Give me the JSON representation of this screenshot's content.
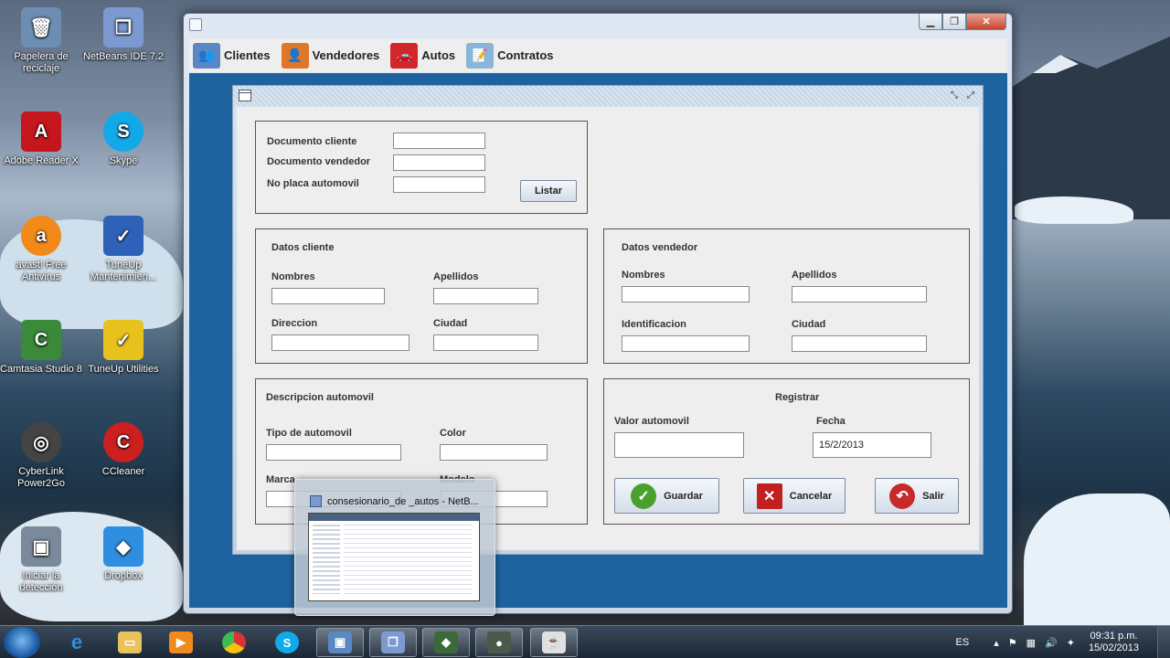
{
  "desktop": {
    "icons": [
      {
        "label": "Papelera de reciclaje",
        "glyph": "🗑",
        "color": "#6d8db3"
      },
      {
        "label": "NetBeans IDE 7.2",
        "glyph": "❒",
        "color": "#7c9ad0"
      },
      {
        "label": "Adobe Reader X",
        "glyph": "A",
        "color": "#c4161c"
      },
      {
        "label": "Skype",
        "glyph": "S",
        "color": "#12a9e9"
      },
      {
        "label": "avast! Free Antivirus",
        "glyph": "a",
        "color": "#f28a1a"
      },
      {
        "label": "TuneUp Mantenimien...",
        "glyph": "✓",
        "color": "#2d62b8"
      },
      {
        "label": "Camtasia Studio 8",
        "glyph": "C",
        "color": "#3a8a3a"
      },
      {
        "label": "TuneUp Utilities",
        "glyph": "✓",
        "color": "#e7c21c"
      },
      {
        "label": "CyberLink Power2Go",
        "glyph": "◎",
        "color": "#444444"
      },
      {
        "label": "CCleaner",
        "glyph": "C",
        "color": "#cc2020"
      },
      {
        "label": "Iniciar la detección",
        "glyph": "▣",
        "color": "#7a8a9a"
      },
      {
        "label": "Dropbox",
        "glyph": "◆",
        "color": "#2e8ee0"
      }
    ]
  },
  "window": {
    "menu": [
      {
        "label": "Clientes",
        "icon": "clients-icon",
        "glyph": "👥",
        "color": "#5b87c4"
      },
      {
        "label": "Vendedores",
        "icon": "seller-icon",
        "glyph": "👤",
        "color": "#e0762a"
      },
      {
        "label": "Autos",
        "icon": "car-icon",
        "glyph": "🚗",
        "color": "#d3262a"
      },
      {
        "label": "Contratos",
        "icon": "contract-icon",
        "glyph": "📝",
        "color": "#8ab4d8"
      }
    ]
  },
  "form": {
    "search": {
      "doc_cliente_label": "Documento cliente",
      "doc_vendedor_label": "Documento vendedor",
      "placa_label": "No placa automovil",
      "listar_button": "Listar"
    },
    "cliente": {
      "title": "Datos cliente",
      "nombres_label": "Nombres",
      "apellidos_label": "Apellidos",
      "direccion_label": "Direccion",
      "ciudad_label": "Ciudad"
    },
    "vendedor": {
      "title": "Datos vendedor",
      "nombres_label": "Nombres",
      "apellidos_label": "Apellidos",
      "identificacion_label": "Identificacion",
      "ciudad_label": "Ciudad"
    },
    "automovil": {
      "title": "Descripcion automovil",
      "tipo_label": "Tipo de automovil",
      "color_label": "Color",
      "marca_label": "Marca",
      "modelo_label": "Modelo"
    },
    "registrar": {
      "title": "Registrar",
      "valor_label": "Valor automovil",
      "fecha_label": "Fecha",
      "fecha_value": "15/2/2013",
      "guardar_button": "Guardar",
      "cancelar_button": "Cancelar",
      "salir_button": "Salir"
    }
  },
  "preview": {
    "title": "consesionario_de _autos - NetB..."
  },
  "taskbar": {
    "language": "ES",
    "time": "09:31 p.m.",
    "date": "15/02/2013"
  }
}
